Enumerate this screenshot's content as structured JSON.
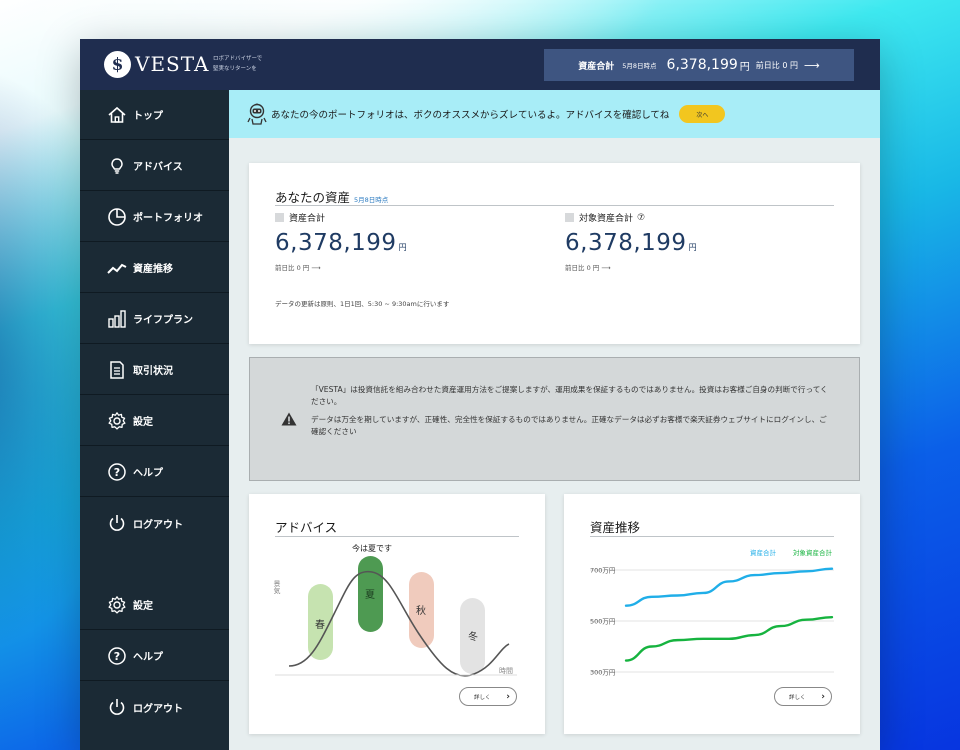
{
  "header": {
    "logo_mark": "$",
    "logo_text": "VESTA",
    "tagline_line1": "ロボアドバイザーで",
    "tagline_line2": "堅実なリターンを",
    "total_label": "資産合計",
    "total_date": "5月8日時点",
    "total_value": "6,378,199",
    "total_yen": "円",
    "total_diff": "前日比 0 円",
    "total_arrow": "⟶"
  },
  "sidebar": {
    "items": [
      {
        "label": "トップ",
        "icon": "home-icon"
      },
      {
        "label": "アドバイス",
        "icon": "lightbulb-icon"
      },
      {
        "label": "ポートフォリオ",
        "icon": "pie-chart-icon"
      },
      {
        "label": "資産推移",
        "icon": "trend-line-icon"
      },
      {
        "label": "ライフプラン",
        "icon": "bar-chart-icon"
      },
      {
        "label": "取引状況",
        "icon": "document-icon"
      },
      {
        "label": "設定",
        "icon": "gear-icon"
      },
      {
        "label": "ヘルプ",
        "icon": "help-icon"
      },
      {
        "label": "ログアウト",
        "icon": "power-icon"
      },
      {
        "label": "設定",
        "icon": "gear-icon"
      },
      {
        "label": "ヘルプ",
        "icon": "help-icon"
      },
      {
        "label": "ログアウト",
        "icon": "power-icon"
      }
    ]
  },
  "banner": {
    "message": "あなたの今のポートフォリオは、ボクのオススメからズレているよ。アドバイスを確認してね",
    "button": "次へ"
  },
  "assets": {
    "title": "あなたの資産",
    "date": "5月8日時点",
    "total": {
      "label": "資産合計",
      "value": "6,378,199",
      "yen": "円",
      "diff": "前日比 0 円 ⟶"
    },
    "target": {
      "label": "対象資産合計",
      "help_icon": "⑦",
      "value": "6,378,199",
      "yen": "円",
      "diff": "前日比 0 円 ⟶"
    },
    "note": "データの更新は原則、1日1回、5:30 ~ 9:30amに行います"
  },
  "warning": {
    "icon": "warning-icon",
    "para1": "「VESTA」は投資信託を組み合わせた資産運用方法をご提案しますが、運用成果を保証するものではありません。投資はお客様ご自身の判断で行ってください。",
    "para2": "データは万全を期していますが、正確性、完全性を保証するものではありません。正確なデータは必ずお客様で楽天証券ウェブサイトにログインし、ご確認ください"
  },
  "advice_card": {
    "title": "アドバイス",
    "current_label": "今は夏です",
    "y_axis": "景気",
    "x_axis": "時間",
    "seasons": [
      "春",
      "夏",
      "秋",
      "冬"
    ],
    "season_colors": [
      "#c6e3b0",
      "#4e9a52",
      "#f0cbbd",
      "#e3e3e3"
    ],
    "button": "詳しく"
  },
  "trend_card": {
    "title": "資産推移",
    "button": "詳しく"
  },
  "chart_data": {
    "type": "line",
    "title": "資産推移",
    "xlabel": "",
    "ylabel": "",
    "y_ticks": [
      "700万円",
      "500万円",
      "300万円"
    ],
    "y_tick_values": [
      700,
      500,
      300
    ],
    "ylim": [
      300,
      700
    ],
    "grid": true,
    "legend_position": "top-right",
    "x": [
      0,
      1,
      2,
      3,
      4,
      5,
      6,
      7,
      8
    ],
    "series": [
      {
        "name": "資産合計",
        "color": "#20aee8",
        "values": [
          560,
          595,
          600,
          610,
          655,
          680,
          688,
          695,
          705
        ]
      },
      {
        "name": "対象資産合計",
        "color": "#16b33f",
        "values": [
          345,
          400,
          425,
          430,
          430,
          445,
          480,
          505,
          515
        ]
      }
    ]
  }
}
